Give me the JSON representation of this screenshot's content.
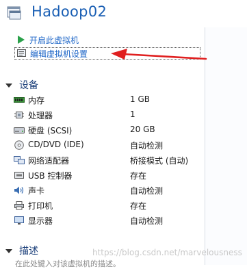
{
  "header": {
    "title": "Hadoop02"
  },
  "actions": {
    "start_label": "开启此虚拟机",
    "edit_label": "编辑虚拟机设置"
  },
  "devices": {
    "heading": "设备",
    "items": [
      {
        "name": "内存",
        "value": "1 GB",
        "icon": "memory-icon"
      },
      {
        "name": "处理器",
        "value": "1",
        "icon": "cpu-icon"
      },
      {
        "name": "硬盘 (SCSI)",
        "value": "20 GB",
        "icon": "hard-disk-icon"
      },
      {
        "name": "CD/DVD (IDE)",
        "value": "自动检测",
        "icon": "cd-dvd-icon"
      },
      {
        "name": "网络适配器",
        "value": "桥接模式 (自动)",
        "icon": "network-adapter-icon"
      },
      {
        "name": "USB 控制器",
        "value": "存在",
        "icon": "usb-icon"
      },
      {
        "name": "声卡",
        "value": "自动检测",
        "icon": "sound-card-icon"
      },
      {
        "name": "打印机",
        "value": "存在",
        "icon": "printer-icon"
      },
      {
        "name": "显示器",
        "value": "自动检测",
        "icon": "display-icon"
      }
    ]
  },
  "description": {
    "heading": "描述",
    "placeholder": "在此处键入对该虚拟机的描述。"
  },
  "watermark": "https://blog.csdn.net/marvelousness",
  "colors": {
    "title": "#1a5fb4",
    "link": "#1b64c7",
    "annotation_arrow": "#e02020"
  }
}
